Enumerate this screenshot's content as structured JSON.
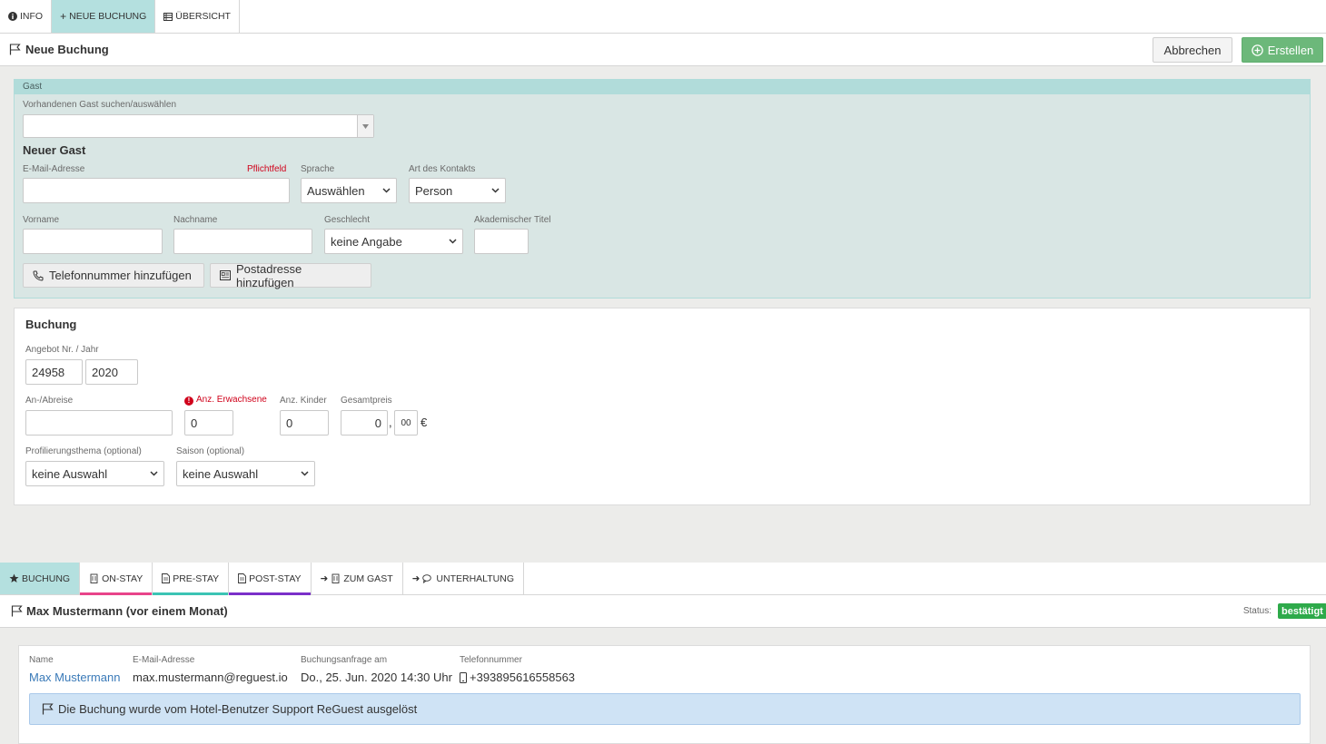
{
  "top_tabs": [
    {
      "label": "INFO",
      "icon": "info-icon"
    },
    {
      "label": "NEUE BUCHUNG",
      "icon": "plus-icon"
    },
    {
      "label": "ÜBERSICHT",
      "icon": "list-icon"
    }
  ],
  "header": {
    "title": "Neue Buchung",
    "cancel_label": "Abbrechen",
    "create_label": "Erstellen"
  },
  "guest": {
    "section_label": "Gast",
    "search_label": "Vorhandenen Gast suchen/auswählen",
    "search_value": "",
    "new_guest_title": "Neuer Gast",
    "email_label": "E-Mail-Adresse",
    "required_label": "Pflichtfeld",
    "language_label": "Sprache",
    "language_value": "Auswählen",
    "contact_type_label": "Art des Kontakts",
    "contact_type_value": "Person",
    "firstname_label": "Vorname",
    "lastname_label": "Nachname",
    "gender_label": "Geschlecht",
    "gender_value": "keine Angabe",
    "title_label": "Akademischer Titel",
    "add_phone_label": "Telefonnummer hinzufügen",
    "add_address_label": "Postadresse hinzufügen"
  },
  "booking": {
    "title": "Buchung",
    "offer_label": "Angebot Nr. / Jahr",
    "offer_number": "24958",
    "offer_year": "2020",
    "dates_label": "An-/Abreise",
    "adults_label": "Anz. Erwachsene",
    "adults_value": "0",
    "children_label": "Anz. Kinder",
    "children_value": "0",
    "price_label": "Gesamtpreis",
    "price_value": "0",
    "price_sep": ",",
    "price_cents": "00",
    "currency": "€",
    "profiling_label": "Profilierungsthema (optional)",
    "profiling_value": "keine Auswahl",
    "season_label": "Saison (optional)",
    "season_value": "keine Auswahl"
  },
  "bottom_tabs": [
    {
      "label": "BUCHUNG",
      "icon": "star-icon",
      "color": ""
    },
    {
      "label": "ON-STAY",
      "icon": "building-icon",
      "color": "#e8448a"
    },
    {
      "label": "PRE-STAY",
      "icon": "document-icon",
      "color": "#3cc4b4"
    },
    {
      "label": "POST-STAY",
      "icon": "document-icon",
      "color": "#7b2fc9"
    },
    {
      "label": "ZUM GAST",
      "icon": "arrow-building-icon",
      "color": ""
    },
    {
      "label": "UNTERHALTUNG",
      "icon": "arrow-chat-icon",
      "color": ""
    }
  ],
  "conversation": {
    "title": "Max Mustermann (vor einem Monat)",
    "status_label": "Status:",
    "status_value": "bestätigt",
    "status_color": "#2eaa4a",
    "name_label": "Name",
    "name_value": "Max Mustermann",
    "email_label": "E-Mail-Adresse",
    "email_value": "max.mustermann@reguest.io",
    "request_label": "Buchungsanfrage am",
    "request_value": "Do., 25. Jun. 2020 14:30 Uhr",
    "phone_label": "Telefonnummer",
    "phone_value": "+393895616558563",
    "note": "Die Buchung wurde vom Hotel-Benutzer Support ReGuest ausgelöst"
  }
}
